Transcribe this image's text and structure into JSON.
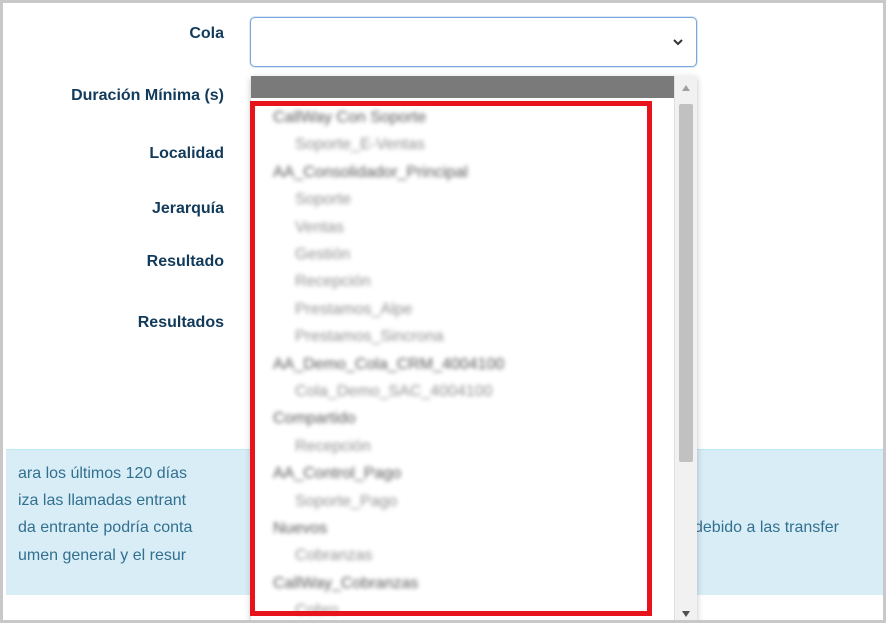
{
  "form": {
    "cola_label": "Cola",
    "duracion_label": "Duración Mínima (s)",
    "localidad_label": "Localidad",
    "jerarquia_label": "Jerarquía",
    "resultado_label": "Resultado",
    "resultados_label": "Resultados",
    "cola_value": ""
  },
  "info": {
    "line1": "ara los últimos 120 días",
    "line2": "iza las llamadas entrant",
    "line3a": "da entrante podría conta",
    "line3b": "debido a las transfer",
    "line4": "umen general y el resur"
  },
  "dropdown": {
    "options": [
      {
        "kind": "group",
        "text": "CallWay Con Soporte"
      },
      {
        "kind": "child",
        "text": "Soporte_E-Ventas"
      },
      {
        "kind": "group",
        "text": "AA_Consolidador_Principal"
      },
      {
        "kind": "child",
        "text": "Soporte"
      },
      {
        "kind": "child",
        "text": "Ventas"
      },
      {
        "kind": "child",
        "text": "Gestión"
      },
      {
        "kind": "child",
        "text": "Recepción"
      },
      {
        "kind": "child",
        "text": "Prestamos_Alpe"
      },
      {
        "kind": "child",
        "text": "Prestamos_Sincrona"
      },
      {
        "kind": "group",
        "text": "AA_Demo_Cola_CRM_4004100"
      },
      {
        "kind": "child",
        "text": "Cola_Demo_SAC_4004100"
      },
      {
        "kind": "group",
        "text": "Compartido"
      },
      {
        "kind": "child",
        "text": "Recepción"
      },
      {
        "kind": "group",
        "text": "AA_Control_Pago"
      },
      {
        "kind": "child",
        "text": "Soporte_Pago"
      },
      {
        "kind": "group",
        "text": "Nuevos"
      },
      {
        "kind": "child",
        "text": "Cobranzas"
      },
      {
        "kind": "group",
        "text": "CallWay_Cobranzas"
      },
      {
        "kind": "child",
        "text": "Cobro"
      }
    ]
  },
  "colors": {
    "highlight": "#e8141c",
    "label": "#123a5a",
    "info_bg": "#d9edf7",
    "info_text": "#31708f"
  },
  "icons": {
    "select_chevron": "chevron-down-icon",
    "scroll_up": "triangle-up-icon",
    "scroll_down": "triangle-down-icon"
  }
}
